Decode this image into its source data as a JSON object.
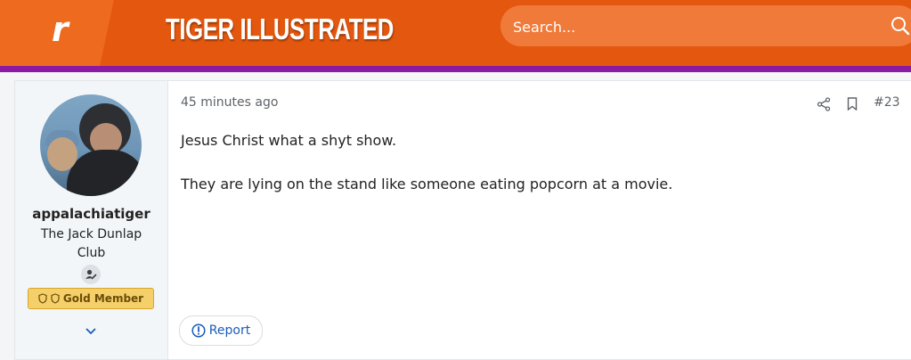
{
  "header": {
    "logo_letter": "r",
    "brand": "TIGER ILLUSTRATED",
    "search_placeholder": "Search...",
    "colors": {
      "primary": "#e4570e",
      "accent_bar": "#8b1aa0"
    }
  },
  "post": {
    "author": {
      "username": "appalachiatiger",
      "title": "The Jack Dunlap Club",
      "badge": "Gold Member"
    },
    "time": "45 minutes ago",
    "number": "#23",
    "body": [
      "Jesus Christ what a shyt show.",
      "They are lying on the stand like someone eating popcorn at a movie."
    ],
    "actions": {
      "report_label": "Report",
      "icons": [
        "share-icon",
        "bookmark-icon",
        "report-icon"
      ]
    }
  }
}
